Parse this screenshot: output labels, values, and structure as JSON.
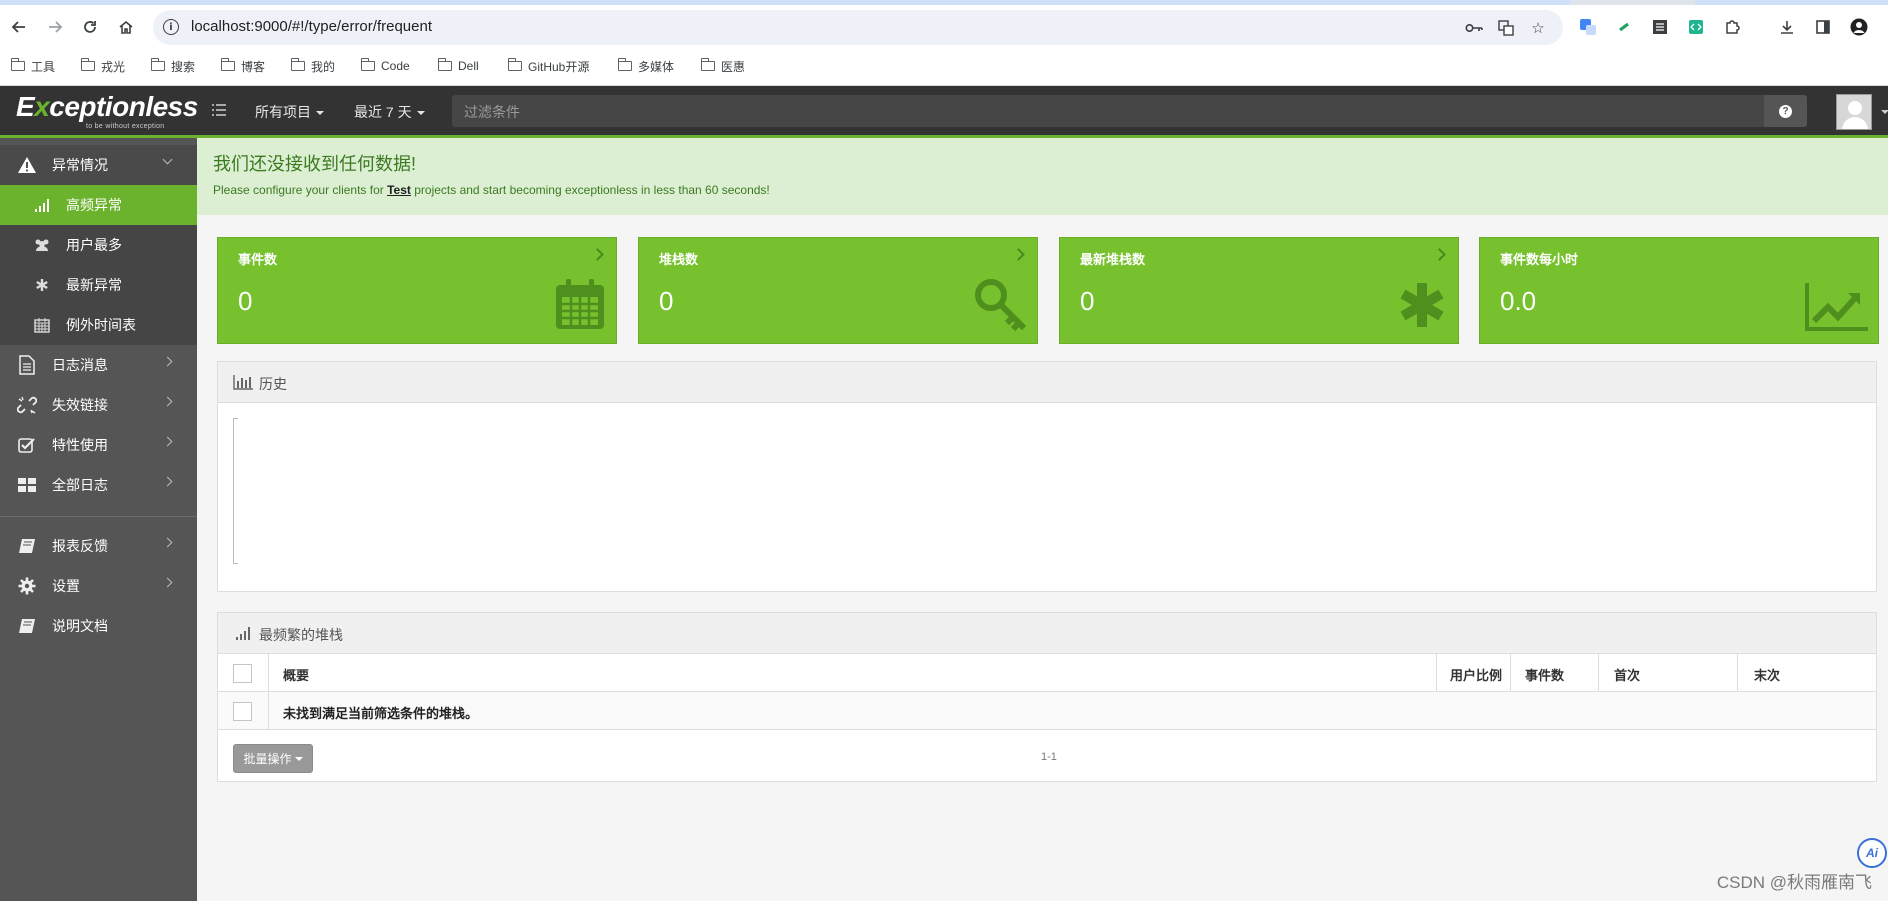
{
  "browser": {
    "url": "localhost:9000/#!/type/error/frequent",
    "bookmarks": [
      "工具",
      "戎光",
      "搜索",
      "博客",
      "我的",
      "Code",
      "Dell",
      "GitHub开源",
      "多媒体",
      "医惠"
    ]
  },
  "header": {
    "logo_word": "Exceptionless",
    "logo_tagline": "to be without exception",
    "project_dropdown": "所有项目",
    "time_dropdown": "最近 7 天",
    "filter_placeholder": "过滤条件",
    "help_label": "?"
  },
  "sidebar": {
    "sections": [
      {
        "label": "异常情况",
        "icon": "warning-icon",
        "expanded": true
      },
      {
        "label": "日志消息",
        "icon": "file-text-icon"
      },
      {
        "label": "失效链接",
        "icon": "broken-link-icon"
      },
      {
        "label": "特性使用",
        "icon": "checkbox-icon"
      },
      {
        "label": "全部日志",
        "icon": "dashboard-icon"
      },
      {
        "label": "报表反馈",
        "icon": "book-icon"
      },
      {
        "label": "设置",
        "icon": "gear-icon"
      },
      {
        "label": "说明文档",
        "icon": "book-icon"
      }
    ],
    "sub_items": [
      {
        "label": "高频异常",
        "icon": "signal-icon",
        "active": true
      },
      {
        "label": "用户最多",
        "icon": "users-icon"
      },
      {
        "label": "最新异常",
        "icon": "asterisk-icon"
      },
      {
        "label": "例外时间表",
        "icon": "calendar-icon"
      }
    ]
  },
  "alert": {
    "title": "我们还没接收到任何数据!",
    "text_before": "Please configure your clients for ",
    "project_link": "Test",
    "text_after": " projects and start becoming exceptionless in less than 60 seconds!"
  },
  "stats": [
    {
      "label": "事件数",
      "value": "0",
      "icon": "calendar-icon",
      "has_arrow": true
    },
    {
      "label": "堆栈数",
      "value": "0",
      "icon": "key-icon",
      "has_arrow": true
    },
    {
      "label": "最新堆栈数",
      "value": "0",
      "icon": "asterisk-icon",
      "has_arrow": true
    },
    {
      "label": "事件数每小时",
      "value": "0.0",
      "icon": "trend-chart-icon",
      "has_arrow": false
    }
  ],
  "history_panel": {
    "title": "历史"
  },
  "stacks_panel": {
    "title": "最频繁的堆栈",
    "columns": [
      "概要",
      "用户比例",
      "事件数",
      "首次",
      "末次"
    ],
    "empty_message": "未找到满足当前筛选条件的堆栈。",
    "bulk_action_label": "批量操作",
    "pager_text": "1-1"
  },
  "watermark": "CSDN @秋雨雁南飞",
  "ai_badge": "Ai",
  "colors": {
    "accent_green": "#77c12e",
    "sidebar_bg": "#555555",
    "header_bg": "#333333"
  }
}
